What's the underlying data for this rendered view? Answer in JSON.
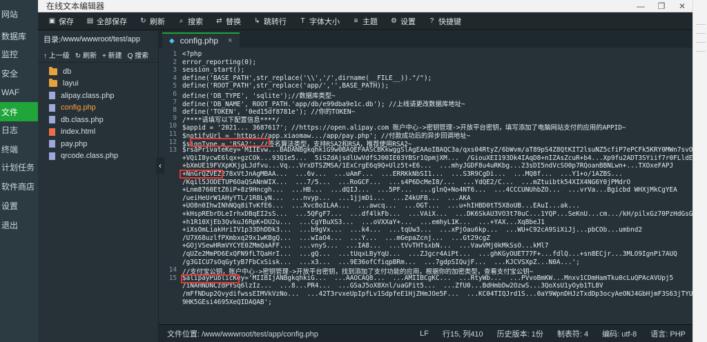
{
  "bg_sidebar": {
    "items": [
      {
        "label": "网站",
        "active": false
      },
      {
        "label": "数据库",
        "active": false
      },
      {
        "label": "监控",
        "active": false
      },
      {
        "label": "安全",
        "active": false
      },
      {
        "label": "WAF",
        "active": false
      },
      {
        "label": "文件",
        "active": true
      },
      {
        "label": "日志",
        "active": false
      },
      {
        "label": "终端",
        "active": false
      },
      {
        "label": "计划任务",
        "active": false
      },
      {
        "label": "软件商店",
        "active": false
      },
      {
        "label": "设置",
        "active": false
      },
      {
        "label": "退出",
        "active": false
      }
    ]
  },
  "window": {
    "title": "在线文本编辑器",
    "minimize": "—",
    "maximize": "❐",
    "close": "✕"
  },
  "toolbar": {
    "items": [
      {
        "label": "保存",
        "icon": "save-icon"
      },
      {
        "label": "全部保存",
        "icon": "save-all-icon"
      },
      {
        "label": "刷新",
        "icon": "refresh-icon"
      },
      {
        "label": "搜索",
        "icon": "search-icon"
      },
      {
        "label": "替换",
        "icon": "replace-icon"
      },
      {
        "label": "跳转行",
        "icon": "goto-icon"
      },
      {
        "label": "字体大小",
        "icon": "font-size-icon"
      },
      {
        "label": "主题",
        "icon": "theme-icon"
      },
      {
        "label": "设置",
        "icon": "settings-icon"
      },
      {
        "label": "快捷键",
        "icon": "help-icon"
      }
    ]
  },
  "filepanel": {
    "dir_prefix": "目录: ",
    "dir_path": "/www/wwwroot/test/app",
    "actions": [
      "↑ 上一级",
      "↻ 刷新",
      "+ 新建",
      "Q 搜索"
    ],
    "files": [
      {
        "name": "db",
        "type": "folder",
        "active": false
      },
      {
        "name": "layui",
        "type": "folder",
        "active": false
      },
      {
        "name": "alipay.class.php",
        "type": "php",
        "active": false
      },
      {
        "name": "config.php",
        "type": "php",
        "active": true
      },
      {
        "name": "db.class.php",
        "type": "php",
        "active": false
      },
      {
        "name": "index.html",
        "type": "html",
        "active": false
      },
      {
        "name": "pay.php",
        "type": "php",
        "active": false
      },
      {
        "name": "qrcode.class.php",
        "type": "php",
        "active": false
      }
    ]
  },
  "editor": {
    "tab_label": "config.php",
    "tab_close": "×",
    "collapse_label": "‹",
    "lines": [
      {
        "n": "1",
        "text": "<?php"
      },
      {
        "n": "2",
        "text": "error_reporting(0);"
      },
      {
        "n": "3",
        "text": "session_start();"
      },
      {
        "n": "4",
        "text": "define('BASE_PATH',str_replace('\\\\','/',dirname(__FILE__)).\"/\");"
      },
      {
        "n": "5",
        "text": "define('ROOT_PATH',str_replace('app/','',BASE_PATH));"
      },
      {
        "n": "6",
        "text": "define('DB_TYPE', 'sqlite');//数据库类型~"
      },
      {
        "n": "7",
        "text": "define('DB_NAME', ROOT_PATH.'app/db/e99dba9e1c.db'); //上线请更改数据库地址~"
      },
      {
        "n": "8",
        "text": "define('TOKEN', '0ed15df8781e'); //你的TOKEN~"
      },
      {
        "n": "9",
        "text": "/****请填写以下配置信息****/"
      },
      {
        "n": "10",
        "text": "$appid = '2021... 3687617'; //https://open.alipay.com 账户中心->密钥管理->开放平台密钥，填写添加了电脑网站支付的应用的APPID~"
      },
      {
        "n": "11",
        "text": "$notifyUrl = 'https://app.xiaomaw.../app/pay.php'; //付款成功后的异步回调地址~"
      },
      {
        "n": "12",
        "text": "$signType = 'RSA2'; //签名算法类型，支持RSA2和RSA，推荐使用RSA2~"
      },
      {
        "n": "13",
        "text": "$rsaPrivateKey='MIIEvw...BADANBgkqhkiG9w0BAQEFAASCBKkwggSlAgEAAoIBAQC3a/qxs04RtyZ/6bWvm/aT89pS4Z8QtKIT2lsuNZ5cfiP7ePCFk5KRY0MWn7svOpMV"
      },
      {
        "n": "",
        "text": "+VQiI8ycwE6lqx+gzCOk...93Q1e5...  5iSZdAjsdlUwVdfSJ00IE03YBSr1QpmjXM...  /GiouXEI193Dk4IAqD8+nIZAsZcuR+b4...Xp9fu2ADT3SYiif7r0FLldES8"
      },
      {
        "n": "",
        "text": "+bXmUE19FVXpKKjgLJdfvu...Vq...VrxDTSZMSA/1ExCrgE6q9Q+Ulz5t+E6...  ...mhyJGDF8u4uRKbg...23sDI5ndVcSO0p7RQoanBBNLwn+...TXOxeFAPJ"
      },
      {
        "n": "",
        "text": "+NnGrQZVEZ278xVtJnAgMBAA...  ...6v...  ...uAmF...  ...ERRKkNbSI1...  ...S3R9CgDi...  ...MQ8f...  ...Y1+o/1AZBS..."
      },
      {
        "n": "",
        "text": "/Kqil5JODETUP6OaQSANnWIX...  ...7/5...  ...RoGCF...  ...s4P6DcMeI8/...  ...YdQE2/C...  ...mZtuibtk54XIX4NG6Y0jPMdrO"
      },
      {
        "n": "",
        "text": "+Lnm8760EtZ6iP+8z9Hncgh...  ...HB...  ...dQIJ...  ...5PF...  ...glnQ+No4NT6...  ...4CCCUNUhbZO...  ...vrVa...Bgicbd WHXjMkCgYEA"
      },
      {
        "n": "",
        "text": "/ueiHeUrW1AHyYTL/1R8LyN...  ...nvyp...  ...1jjmDi...  ...Z4kUFB...  ...AKA"
      },
      {
        "n": "",
        "text": "+UO8n0IhwINhNQq8iTvKfE6...  ...Xvc8oILAA...  ...awcq...  ...OGT...  ...u+hIHBD0tT5X8oUB...EAuI...ak..."
      },
      {
        "n": "",
        "text": "+kHspREbrDLeIrhxDBqEI2sS...  ...5QFgF7...  ...df4lkFb...  ...VAiX...  ...DK6SkAU3VO3t70uC...1YQP...SeKnU...cm.../kH/pilxGz70PzHdGsGx"
      },
      {
        "n": "",
        "text": "+h1R10XjEb3QvkuJ6RpK+DU2u...  ...CgYBuXS3...  ...oVXXaY+...  ...emhyL1K...  ...+YAX...XqBbeJ1"
      },
      {
        "n": "",
        "text": "+iXsOmLiakHriIV1p33DhDDk3...  ...b9gVx...  ...k4...  ...tqUw3...  ...xPjOau6kp...  ...WU+C92cA9SiXiJj...pbCOb...umbnd2"
      },
      {
        "n": "",
        "text": "/U7X68uzlfPXmbxq29x1wKBgQ...  ...wIaO4...  ...Y...  ...mGepaZcnj...  ...Gt29cgZ"
      },
      {
        "n": "",
        "text": "+GOjVSewHRmVYCYE0ZMmQaAFF...  ...vnyS...  ...IA8...  ...tVvTHTsxbN...  ...VawVMj0kMkSsO...kMl7"
      },
      {
        "n": "",
        "text": "/qUZe2MmPD6ExQFN9fLTQaHrI...  ...gQ...  ...tUqxLByYqU...  ...ZJgcr4AiPt...  ...ghKGyOUET77F+...fdlQ...+sn8ECjr...3MLO9IgnPi7AUQ"
      },
      {
        "n": "",
        "text": "/g3GICU7sOqGytyB7FbCxSisk...  ...x3...  ...9E36ofCfiqpBRm...  ...7gdpSIQujF...  ...KJCVSXpZ...N0A...'; "
      },
      {
        "n": "14",
        "text": "//支付宝公钥，账户中心->密钥管理->开放平台密钥，找到添加了支付功能的应用，根据你的加密类型，查看支付宝公钥~"
      },
      {
        "n": "15",
        "text": "$alipayPublicKey='MIIBIjANBgkqhkiG...  ...AAOCAQ8...  ...AMIIBCgKC...  ...RtyWb...  ...PVvoBmKW...Mnxv1CDmHamTku0cLuQPAcAVUpj5"
      },
      {
        "n": "",
        "text": "/iNAHNDNCzdPYSq6lzIz...  ...8...PR4...  ...GSaJ5oX8Xnl/uaGFit5...  ...ZfU0...BdHmbDw2OzwS...3QoXsU1yOyb1TL8V"
      },
      {
        "n": "",
        "text": "/mFfNDup2QvydifwssEIMVkVzNo...  ...42T3rvxeUpIpfLv1SdpfeE1HjZHmJOe5F...  ...KC04TIQJrd1S...0aY9WpnDHJzTxdDp3ocyAeONJ4GbHjmF3S63jTYUl"
      },
      {
        "n": "",
        "text": "9HK5GEsi4695XeQIDAQAB';"
      }
    ]
  },
  "statusbar": {
    "path": "文件位置: /www/wwwroot/test/app/config.php",
    "eol": "LF",
    "position": "行15, 列410",
    "history": "历史版本: 1份",
    "tabs": "制表符: 4",
    "encoding": "编码: utf-8",
    "language": "语言: PHP"
  }
}
